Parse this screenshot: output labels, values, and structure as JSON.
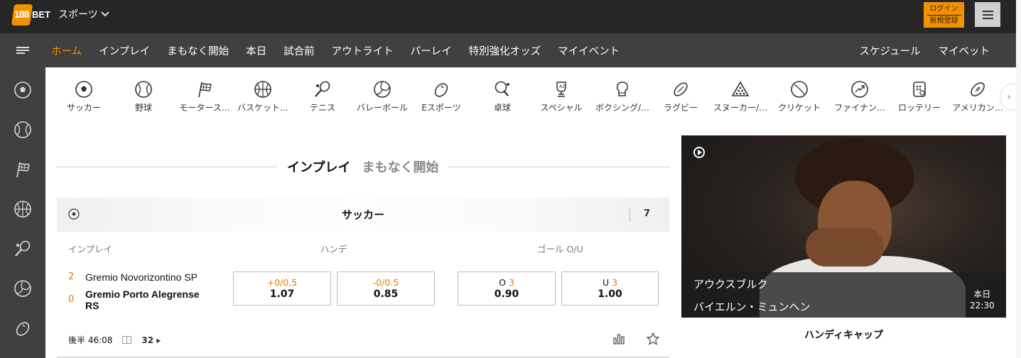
{
  "header": {
    "logo_text": "188BET",
    "sports_menu_label": "スポーツ",
    "login_label": "ログイン",
    "register_label": "新規登録"
  },
  "nav": {
    "items": [
      "ホーム",
      "インプレイ",
      "まもなく開始",
      "本日",
      "試合前",
      "アウトライト",
      "パーレイ",
      "特別強化オッズ",
      "マイイベント"
    ],
    "active_index": 0,
    "right_items": [
      "スケジュール",
      "マイベット"
    ]
  },
  "sidebar": {
    "icons": [
      "soccer-icon",
      "baseball-icon",
      "flag-icon",
      "basketball-icon",
      "tennis-icon",
      "volleyball-icon",
      "esports-icon"
    ]
  },
  "sports": [
    {
      "label": "サッカー",
      "icon": "soccer-icon"
    },
    {
      "label": "野球",
      "icon": "baseball-icon"
    },
    {
      "label": "モータース…",
      "icon": "flag-icon"
    },
    {
      "label": "バスケット…",
      "icon": "basketball-icon"
    },
    {
      "label": "テニス",
      "icon": "tennis-icon"
    },
    {
      "label": "バレーボール",
      "icon": "volleyball-icon"
    },
    {
      "label": "Eスポーツ",
      "icon": "esports-icon"
    },
    {
      "label": "卓球",
      "icon": "table-tennis-icon"
    },
    {
      "label": "スペシャル",
      "icon": "trophy-icon"
    },
    {
      "label": "ボクシング/…",
      "icon": "boxing-icon"
    },
    {
      "label": "ラグビー",
      "icon": "rugby-icon"
    },
    {
      "label": "スヌーカー/…",
      "icon": "snooker-icon"
    },
    {
      "label": "クリケット",
      "icon": "cricket-icon"
    },
    {
      "label": "ファイナン…",
      "icon": "finance-icon"
    },
    {
      "label": "ロッテリー",
      "icon": "lottery-icon"
    },
    {
      "label": "アメリカン…",
      "icon": "american-football-icon"
    }
  ],
  "tabs": {
    "inplay": "インプレイ",
    "soon": "まもなく開始"
  },
  "section": {
    "title": "サッカー",
    "count": "7"
  },
  "columns": {
    "inplay": "インプレイ",
    "handicap": "ハンデ",
    "goal_ou": "ゴール O/U"
  },
  "match": {
    "home_score": "2",
    "away_score": "0",
    "home_team": "Gremio Novorizontino SP",
    "away_team_line1": "Gremio Porto Alegrense",
    "away_team_line2": "RS",
    "handicap_home_line": "+0/0.5",
    "handicap_home_odds": "1.07",
    "handicap_away_line": "-0/0.5",
    "handicap_away_odds": "0.85",
    "over_label": "O",
    "over_line": "3",
    "over_odds": "0.90",
    "under_label": "U",
    "under_line": "3",
    "under_odds": "1.00",
    "period_time": "後半 46:08",
    "more_markets": "32"
  },
  "promo": {
    "team_home": "アウクスブルク",
    "team_away": "バイエルン・ミュンヘン",
    "date_day": "本日",
    "date_time": "22:30",
    "caption": "ハンディキャップ"
  },
  "colors": {
    "accent": "#f39200",
    "topbar": "#262626",
    "navbar": "#404040"
  }
}
